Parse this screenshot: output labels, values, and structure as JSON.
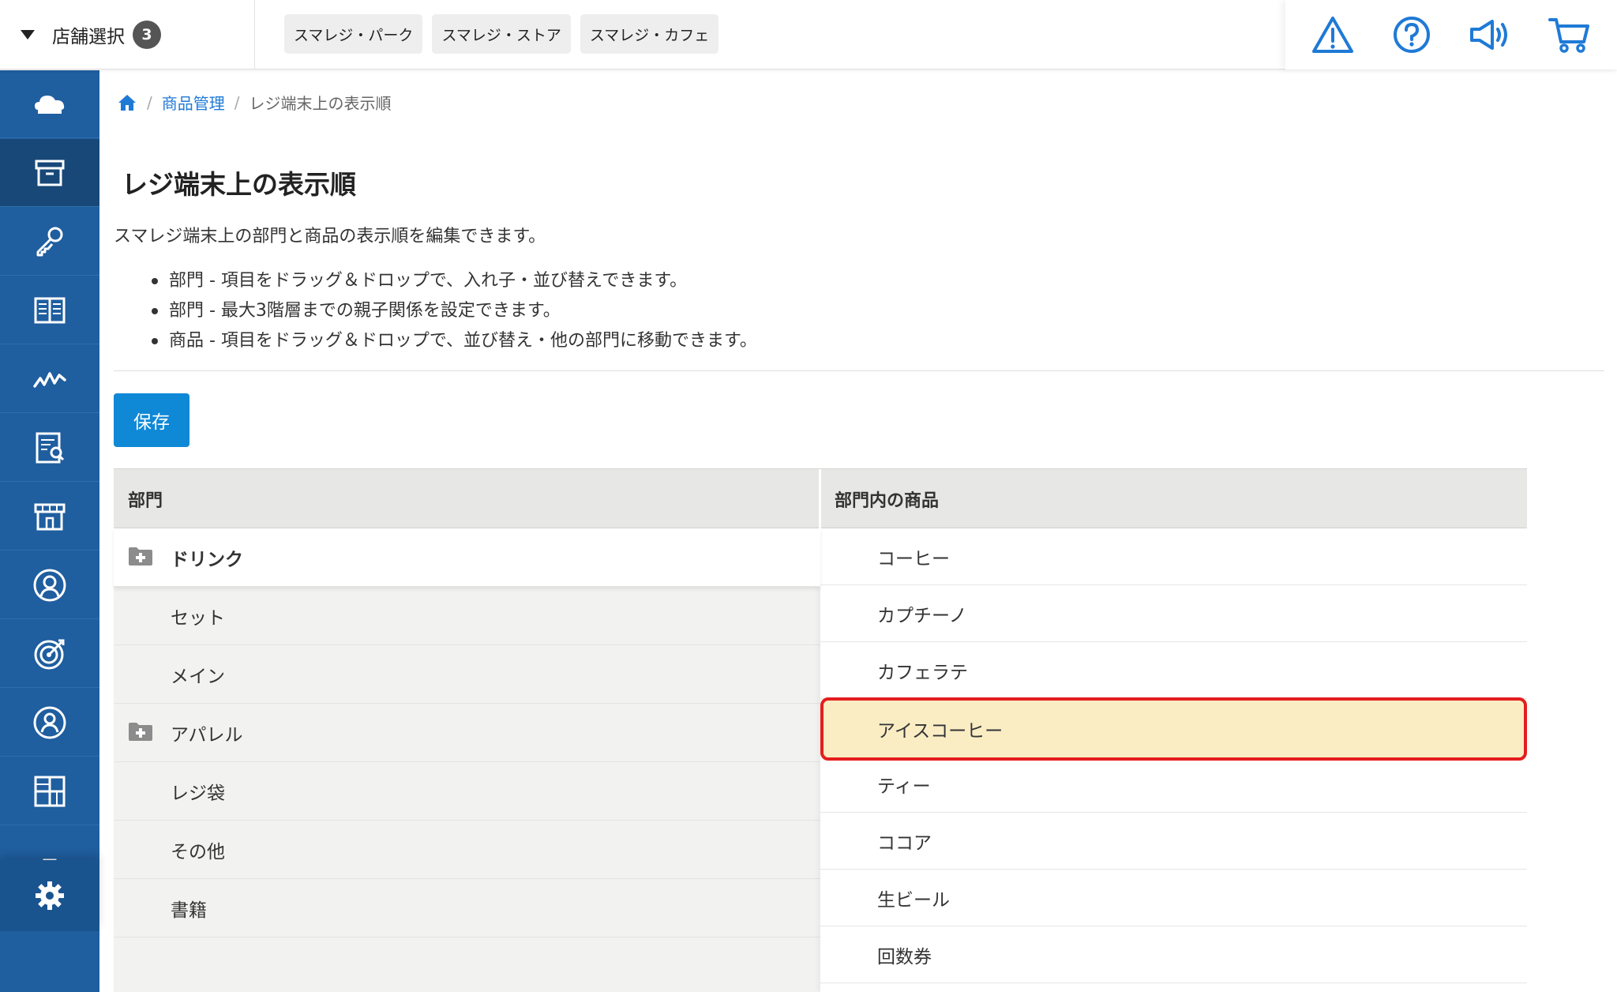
{
  "topbar": {
    "store_select_label": "店舗選択",
    "store_count": "3",
    "stores": [
      "スマレジ・パーク",
      "スマレジ・ストア",
      "スマレジ・カフェ"
    ],
    "icons": [
      "warning-icon",
      "help-icon",
      "announcement-icon",
      "cart-icon"
    ]
  },
  "sidebar": {
    "items": [
      "cloud-icon",
      "archive-box-icon",
      "key-icon",
      "book-icon",
      "analytics-icon",
      "report-icon",
      "store-icon",
      "customer-icon",
      "target-icon",
      "user-icon",
      "apps-icon",
      "clipboard-icon"
    ],
    "active": "archive-box-icon",
    "settings_icon": "gear-icon",
    "colors": {
      "background": "#1f5e9f",
      "active": "#174878"
    }
  },
  "breadcrumb": {
    "parent": "商品管理",
    "current": "レジ端末上の表示順"
  },
  "page": {
    "title": "レジ端末上の表示順",
    "description": "スマレジ端末上の部門と商品の表示順を編集できます。",
    "bullets": [
      "部門 - 項目をドラッグ＆ドロップで、入れ子・並び替えできます。",
      "部門 - 最大3階層までの親子関係を設定できます。",
      "商品 - 項目をドラッグ＆ドロップで、並び替え・他の部門に移動できます。"
    ],
    "save_label": "保存"
  },
  "table": {
    "headers": {
      "department": "部門",
      "products": "部門内の商品"
    },
    "departments": [
      {
        "name": "ドリンク",
        "expandable": true,
        "selected": true
      },
      {
        "name": "セット",
        "expandable": false
      },
      {
        "name": "メイン",
        "expandable": false
      },
      {
        "name": "アパレル",
        "expandable": true
      },
      {
        "name": "レジ袋",
        "expandable": false
      },
      {
        "name": "その他",
        "expandable": false
      },
      {
        "name": "書籍",
        "expandable": false
      }
    ],
    "products": [
      {
        "name": "コーヒー"
      },
      {
        "name": "カプチーノ"
      },
      {
        "name": "カフェラテ"
      },
      {
        "name": "アイスコーヒー",
        "highlighted": true
      },
      {
        "name": "ティー"
      },
      {
        "name": "ココア"
      },
      {
        "name": "生ビール"
      },
      {
        "name": "回数券"
      }
    ],
    "colors": {
      "highlight_fill": "#faedc4",
      "highlight_border": "#e41e1e",
      "accent": "#0f88d6"
    }
  }
}
